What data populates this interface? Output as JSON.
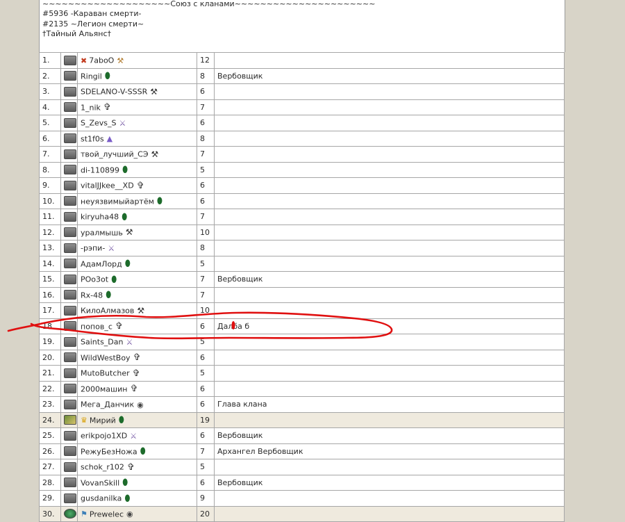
{
  "header": {
    "lines": [
      "~~~~~~~~~~~~~~~~~~~~Союз с кланами~~~~~~~~~~~~~~~~~~~~~~",
      "#5936 -Караван смерти-",
      "#2135 ~Легион смерти~",
      "†Тайный Альянс†"
    ]
  },
  "members": [
    {
      "num": "1.",
      "nick": "7aboO",
      "level": "12",
      "role": "",
      "icon": "hammer-icon",
      "prefix": "clan-mark-icon"
    },
    {
      "num": "2.",
      "nick": "Ringil",
      "level": "8",
      "role": "Вербовщик",
      "icon": "leaf-icon"
    },
    {
      "num": "3.",
      "nick": "SDELANO-V-SSSR",
      "level": "6",
      "role": "",
      "icon": "scythe-icon"
    },
    {
      "num": "4.",
      "nick": "1_nik",
      "level": "7",
      "role": "",
      "icon": "cross-icon"
    },
    {
      "num": "5.",
      "nick": "S_Zevs_S",
      "level": "6",
      "role": "",
      "icon": "sword-icon"
    },
    {
      "num": "6.",
      "nick": "st1f0s",
      "level": "8",
      "role": "",
      "icon": "wizard-hat-icon"
    },
    {
      "num": "7.",
      "nick": "твой_лучший_СЭ",
      "level": "7",
      "role": "",
      "icon": "scythe-icon"
    },
    {
      "num": "8.",
      "nick": "di-110899",
      "level": "5",
      "role": "",
      "icon": "leaf-icon"
    },
    {
      "num": "9.",
      "nick": "vitalJJkee__XD",
      "level": "6",
      "role": "",
      "icon": "cross-icon"
    },
    {
      "num": "10.",
      "nick": "неуязвимыйартём",
      "level": "6",
      "role": "",
      "icon": "leaf-icon"
    },
    {
      "num": "11.",
      "nick": "kiryuha48",
      "level": "7",
      "role": "",
      "icon": "leaf-icon"
    },
    {
      "num": "12.",
      "nick": "уралмышь",
      "level": "10",
      "role": "",
      "icon": "scythe-icon"
    },
    {
      "num": "13.",
      "nick": "-рэпи-",
      "level": "8",
      "role": "",
      "icon": "sword-icon"
    },
    {
      "num": "14.",
      "nick": "АдамЛорд",
      "level": "5",
      "role": "",
      "icon": "leaf-icon"
    },
    {
      "num": "15.",
      "nick": "POo3ot",
      "level": "7",
      "role": "Вербовщик",
      "icon": "leaf-icon"
    },
    {
      "num": "16.",
      "nick": "Rx-48",
      "level": "7",
      "role": "",
      "icon": "leaf-icon"
    },
    {
      "num": "17.",
      "nick": "КилоАлмазов",
      "level": "10",
      "role": "",
      "icon": "scythe-icon"
    },
    {
      "num": "18.",
      "nick": "попов_с",
      "level": "6",
      "role": "Далба б",
      "icon": "cross-icon"
    },
    {
      "num": "19.",
      "nick": "Saints_Dan",
      "level": "5",
      "role": "",
      "icon": "sword-icon"
    },
    {
      "num": "20.",
      "nick": "WildWestBoy",
      "level": "6",
      "role": "",
      "icon": "cross-icon"
    },
    {
      "num": "21.",
      "nick": "MutoButcher",
      "level": "5",
      "role": "",
      "icon": "cross-icon"
    },
    {
      "num": "22.",
      "nick": "2000машин",
      "level": "6",
      "role": "",
      "icon": "cross-icon"
    },
    {
      "num": "23.",
      "nick": "Мега_Данчик",
      "level": "6",
      "role": "Глава клана",
      "icon": "helmet-icon"
    },
    {
      "num": "24.",
      "nick": "Мирий",
      "level": "19",
      "role": "",
      "icon": "leaf-icon",
      "prefix": "crown-icon",
      "highlight": true,
      "rank": "quill"
    },
    {
      "num": "25.",
      "nick": "erikpojo1XD",
      "level": "6",
      "role": "Вербовщик",
      "icon": "sword-icon"
    },
    {
      "num": "26.",
      "nick": "РежуБезНожа",
      "level": "7",
      "role": "Архангел Вербовщик",
      "icon": "leaf-icon"
    },
    {
      "num": "27.",
      "nick": "schok_r102",
      "level": "5",
      "role": "",
      "icon": "cross-icon"
    },
    {
      "num": "28.",
      "nick": "VovanSkill",
      "level": "6",
      "role": "Вербовщик",
      "icon": "leaf-icon"
    },
    {
      "num": "29.",
      "nick": "gusdanilka",
      "level": "9",
      "role": "",
      "icon": "leaf-icon"
    },
    {
      "num": "30.",
      "nick": "Prewelec",
      "level": "20",
      "role": "",
      "icon": "helmet-icon",
      "prefix": "flag-icon",
      "highlight": true,
      "rank": "gem"
    }
  ],
  "annotation": {
    "color": "#e01010"
  }
}
